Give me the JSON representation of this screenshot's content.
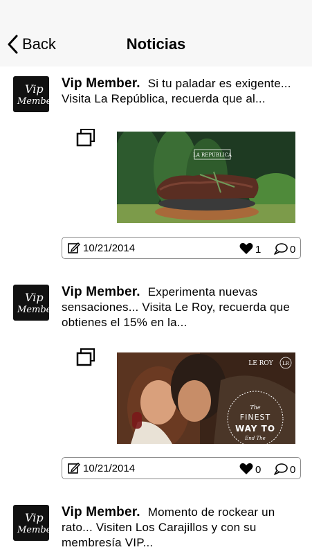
{
  "nav": {
    "back_label": "Back",
    "title": "Noticias"
  },
  "posts": [
    {
      "author": "Vip Member.",
      "text": "Si tu paladar es exigente... Visita La República, recuerda que al...",
      "photo_caption": "LA REPÚBLICA",
      "date": "10/21/2014",
      "likes": "1",
      "comments": "0"
    },
    {
      "author": "Vip Member.",
      "text": "Experimenta nuevas sensaciones... Visita Le Roy, recuerda que obtienes el 15% en la...",
      "photo_caption": "LE ROY",
      "photo_badge": "LR",
      "photo_lines": [
        "The",
        "FINEST",
        "WAY TO",
        "End The"
      ],
      "date": "10/21/2014",
      "likes": "0",
      "comments": "0"
    },
    {
      "author": "Vip Member.",
      "text": "Momento de rockear un rato... Visiten Los Carajillos y con su membresía VIP..."
    }
  ],
  "avatar_text": [
    "Vip",
    "Member"
  ],
  "colors": {
    "topbar": "#f7f7f7",
    "card_border": "#8a8a8a",
    "avatar_bg": "#111111"
  },
  "icons": {
    "back": "chevron-left-icon",
    "gallery": "gallery-icon",
    "date": "edit-icon",
    "likes": "heart-icon",
    "comments": "comment-bubble-icon"
  }
}
